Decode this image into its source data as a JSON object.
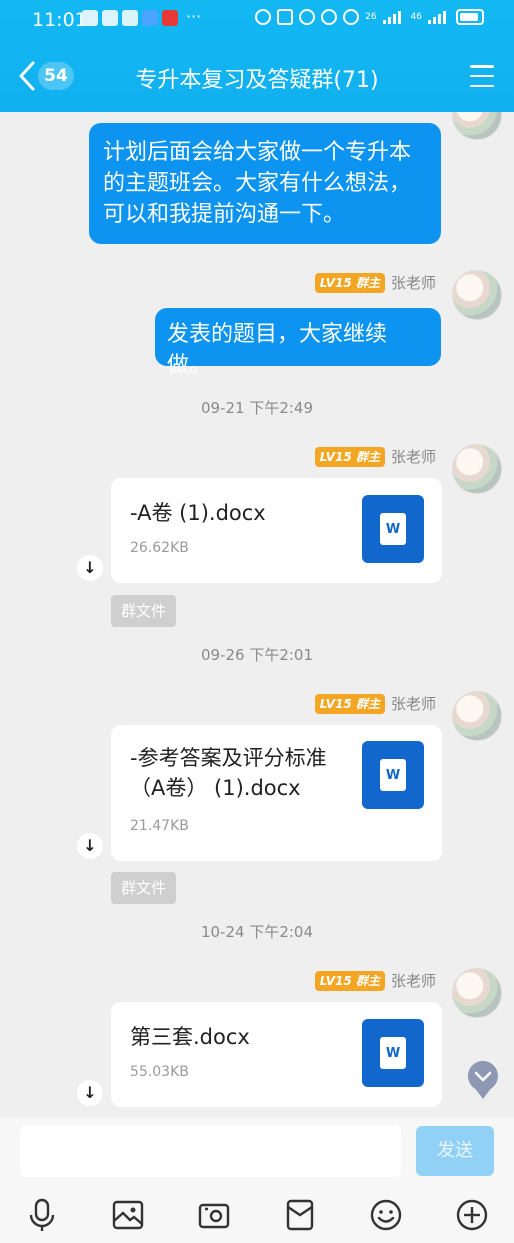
{
  "status_bar": {
    "time": "11:01",
    "dots": "···",
    "net_label_1": "26",
    "net_label_2": "46"
  },
  "header": {
    "back_count": "54",
    "title": "专升本复习及答疑群(71)"
  },
  "messages": [
    {
      "type": "text",
      "text": "计划后面会给大家做一个专升本的主题班会。大家有什么想法，可以和我提前沟通一下。"
    },
    {
      "type": "text",
      "sender": "张老师",
      "level": "LV15",
      "role": "群主",
      "text": "发表的题目，大家继续做。"
    }
  ],
  "timestamps": [
    "09-21 下午2:49",
    "09-26 下午2:01",
    "10-24 下午2:04"
  ],
  "files": [
    {
      "sender": "张老师",
      "level": "LV15",
      "role": "群主",
      "name": "-A卷 (1).docx",
      "size": "26.62KB",
      "tag": "群文件"
    },
    {
      "sender": "张老师",
      "level": "LV15",
      "role": "群主",
      "name": "-参考答案及评分标准（A卷） (1).docx",
      "size": "21.47KB",
      "tag": "群文件"
    },
    {
      "sender": "张老师",
      "level": "LV15",
      "role": "群主",
      "name": "第三套.docx",
      "size": "55.03KB"
    }
  ],
  "file_icon_letter": "W",
  "input": {
    "placeholder": "",
    "send_label": "发送"
  },
  "toolbar_icons": [
    "microphone-icon",
    "image-icon",
    "camera-icon",
    "red-packet-icon",
    "emoji-icon",
    "plus-icon"
  ],
  "colors": {
    "header": "#13b8f2",
    "bubble": "#0d93f0",
    "word": "#1167cc",
    "level_tag": "#f2a623"
  }
}
